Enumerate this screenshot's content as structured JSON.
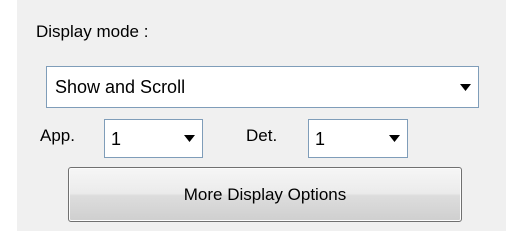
{
  "display_panel": {
    "display_mode_label": "Display mode :",
    "display_mode_value": "Show and Scroll",
    "app_label": "App.",
    "app_value": "1",
    "det_label": "Det.",
    "det_value": "1",
    "more_options_label": "More Display Options"
  },
  "icons": {
    "dropdown": "chevron-down-icon"
  },
  "colors": {
    "panel_background": "#f0f0f0",
    "field_border": "#7f9db9",
    "button_border": "#707070"
  }
}
